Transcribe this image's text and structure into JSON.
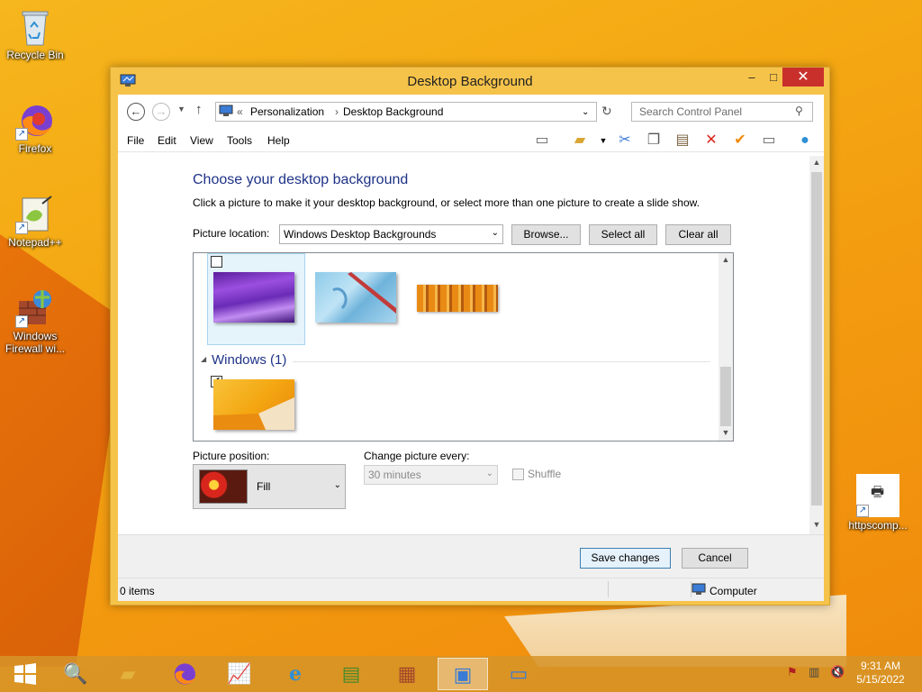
{
  "desktop": {
    "icons": [
      {
        "label": "Recycle Bin",
        "icon": "recycle-bin-icon"
      },
      {
        "label": "Firefox",
        "icon": "firefox-icon"
      },
      {
        "label": "Notepad++",
        "icon": "notepad-plus-plus-icon"
      },
      {
        "label": "Windows Firewall wi...",
        "icon": "firewall-icon"
      },
      {
        "label": "httpscomp...",
        "icon": "url-shortcut-icon"
      }
    ]
  },
  "window": {
    "title": "Desktop Background",
    "controls": {
      "minimize": "–",
      "maximize": "□",
      "close": "✕"
    },
    "address": {
      "prefix": "«",
      "crumbs": [
        "Personalization",
        "Desktop Background"
      ],
      "separator": "›"
    },
    "search": {
      "placeholder": "Search Control Panel"
    },
    "menu": [
      "File",
      "Edit",
      "View",
      "Tools",
      "Help"
    ],
    "heading": "Choose your desktop background",
    "description": "Click a picture to make it your desktop background, or select more than one picture to create a slide show.",
    "picture_location": {
      "label": "Picture location:",
      "value": "Windows Desktop Backgrounds",
      "browse": "Browse...",
      "select_all": "Select all",
      "clear_all": "Clear all"
    },
    "gallery": {
      "group_name": "Windows (1)",
      "images": [
        {
          "name": "purple-waves",
          "checked": false,
          "selected": true
        },
        {
          "name": "blue-abstract",
          "checked": false,
          "selected": false
        },
        {
          "name": "orange-pillars",
          "checked": false,
          "selected": false
        },
        {
          "name": "windows-orange",
          "checked": true,
          "selected": false
        }
      ],
      "check_mark": "✔"
    },
    "picture_position": {
      "label": "Picture position:",
      "value": "Fill"
    },
    "change_every": {
      "label": "Change picture every:",
      "value": "30 minutes"
    },
    "shuffle": {
      "label": "Shuffle",
      "checked": false,
      "enabled": false
    },
    "buttons": {
      "save": "Save changes",
      "cancel": "Cancel"
    },
    "status": {
      "items": "0 items",
      "location": "Computer"
    }
  },
  "taskbar": {
    "apps": [
      "start",
      "search",
      "file-explorer",
      "firefox",
      "resource-monitor",
      "internet-explorer",
      "notepad-plus-plus",
      "firewall",
      "control-panel",
      "remote-desktop"
    ],
    "active_app": "control-panel",
    "clock": {
      "time": "9:31 AM",
      "date": "5/15/2022"
    }
  },
  "colors": {
    "accent": "#f6c34a",
    "heading": "#1e3287",
    "close": "#c9302c"
  }
}
